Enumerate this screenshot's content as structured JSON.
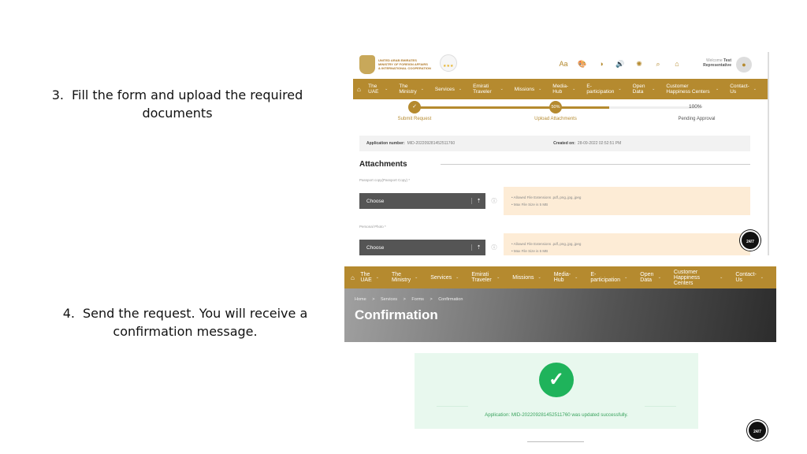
{
  "steps": [
    {
      "num": "3.",
      "text": "Fill the form and upload the required documents"
    },
    {
      "num": "4.",
      "text": "Send the request. You will receive a confirmation message."
    }
  ],
  "header": {
    "logo_lines": [
      "United Arab Emirates",
      "Ministry of Foreign Affairs",
      "& International Cooperation"
    ],
    "tools": [
      "Aa",
      "🎨",
      "◑",
      "🔊",
      "✺",
      "⌕",
      "⌂"
    ],
    "welcome": "Welcome",
    "user": "Test Representative"
  },
  "nav": {
    "items": [
      {
        "label": "The UAE"
      },
      {
        "label": "The Ministry"
      },
      {
        "label": "Services"
      },
      {
        "label": "Emirati Traveler"
      },
      {
        "label": "Missions"
      },
      {
        "label": "Media-Hub"
      },
      {
        "label": "E-participation"
      },
      {
        "label": "Open Data"
      },
      {
        "label": "Customer Happiness Centers"
      },
      {
        "label": "Contact-Us"
      }
    ]
  },
  "progress": {
    "percent": 50,
    "steps": [
      {
        "label": "Submit Request",
        "marker": "✓"
      },
      {
        "label": "Upload Attachments",
        "marker": "50%"
      },
      {
        "label": "Pending Approval",
        "marker": "100%"
      }
    ]
  },
  "application": {
    "number_label": "Application number:",
    "number": "MID-20220928145251​1760",
    "created_label": "Created on:",
    "created": "28-09-2022 02:52:51 PM"
  },
  "attachments": {
    "title": "Attachments",
    "fields": [
      {
        "label": "Passport copy(Passport Copy) *",
        "button": "Choose",
        "notes": [
          "• Allowed File Extensions .pdf,.png,.jpg,.jpeg",
          "• Max File Size is 5 MB"
        ]
      },
      {
        "label": "Personal Photo *",
        "button": "Choose",
        "notes": [
          "• Allowed File Extensions .pdf,.png,.jpg,.jpeg",
          "• Max File Size is 5 MB"
        ]
      }
    ]
  },
  "chat_label": "24/7",
  "confirmation": {
    "breadcrumb": [
      "Home",
      ">",
      "Services",
      ">",
      "Forms",
      ">",
      "Confirmation"
    ],
    "title": "Confirmation",
    "message": "Application: MID-202209281452511760 was updated successfully.",
    "check": "✓"
  },
  "colors": {
    "brand": "#b58a2f",
    "success": "#1fb35b",
    "success_bg": "#e8f8ee",
    "note_bg": "#fdecd6"
  }
}
